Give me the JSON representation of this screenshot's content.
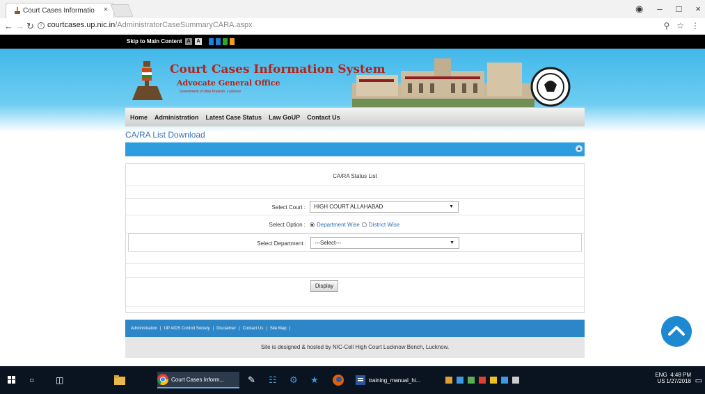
{
  "browser": {
    "tab_title": "Court Cases Informatio",
    "tab_close": "×",
    "url_host": "courtcases.up.nic.in",
    "url_path": "/AdministratorCaseSummaryCARA.aspx",
    "window_controls": [
      "–",
      "□",
      "×"
    ]
  },
  "topstrip": {
    "skip_label": "Skip to Main Content",
    "font_btn_1": "A",
    "font_btn_2": "A",
    "theme_colors": [
      "#1e7fd8",
      "#2aa82f",
      "#f0a020"
    ]
  },
  "header": {
    "title": "Court Cases Information System",
    "subtitle": "Advocate General Office",
    "subtitle2": "Government of Uttar Pradesh, Lucknow"
  },
  "menu": [
    "Home",
    "Administration",
    "Latest Case Status",
    "Law GoUP",
    "Contact Us"
  ],
  "page_heading": "CA/RA List Download",
  "form": {
    "panel_title": "CA/RA Status List",
    "court_label": "Select Court :",
    "court_value": "HIGH COURT ALLAHABAD",
    "option_label": "Select Option :",
    "option_1": "Department Wise",
    "option_2": "District Wise",
    "dept_label": "Select Department :",
    "dept_value": "---Select---",
    "display_button": "Display"
  },
  "footer": {
    "links": [
      "Administration",
      "|",
      "UP AIDS Control Society",
      "|",
      "Disclaimer",
      "|",
      "Contact Us",
      "|",
      "Site Map",
      "|"
    ],
    "note": "Site is designed & hosted by NIC-Cell High Court Lucknow Bench, Lucknow."
  },
  "taskbar": {
    "chrome_label": "Court Cases Inform...",
    "word_label": "training_manual_hi...",
    "lang": "ENG",
    "region": "US",
    "time": "4:48 PM",
    "date": "1/27/2018"
  }
}
